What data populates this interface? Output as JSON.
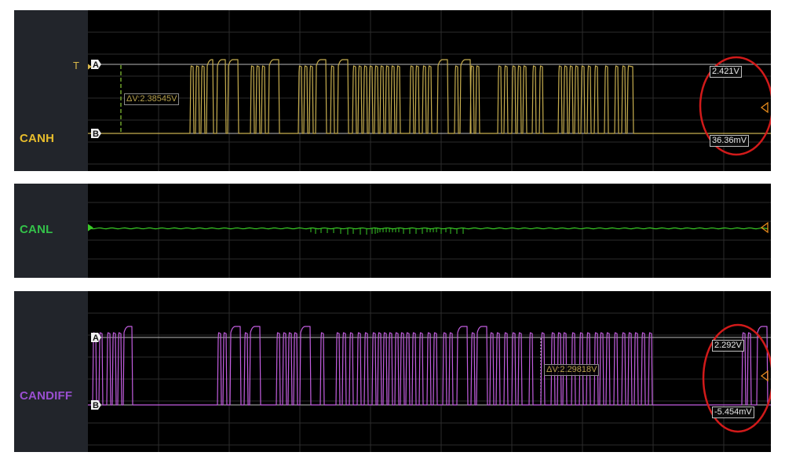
{
  "channels": {
    "canh": {
      "name": "CANH",
      "color": "#d9b84a",
      "trace_color": "#c7ae4f",
      "trigger_label": "T",
      "cursor_a_label": "A",
      "cursor_b_label": "B",
      "delta": "ΔV:2.38545V",
      "cursor_a_value": "2.421V",
      "cursor_b_value": "36.36mV"
    },
    "canl": {
      "name": "CANL",
      "color": "#3cbf42",
      "trace_color": "#39c926"
    },
    "candiff": {
      "name": "CANDIFF",
      "color": "#9a4fd1",
      "trace_color": "#c35ee0",
      "cursor_a_label": "A",
      "cursor_b_label": "B",
      "delta": "ΔV:2.29818V",
      "cursor_a_value": "2.292V",
      "cursor_b_value": "-5.454mV"
    }
  },
  "annotation_color": "#d11a1a",
  "icons": [
    "trigger-arrow-icon",
    "ground-marker-icon",
    "offset-marker-icon",
    "cursor-a-marker",
    "cursor-b-marker"
  ]
}
